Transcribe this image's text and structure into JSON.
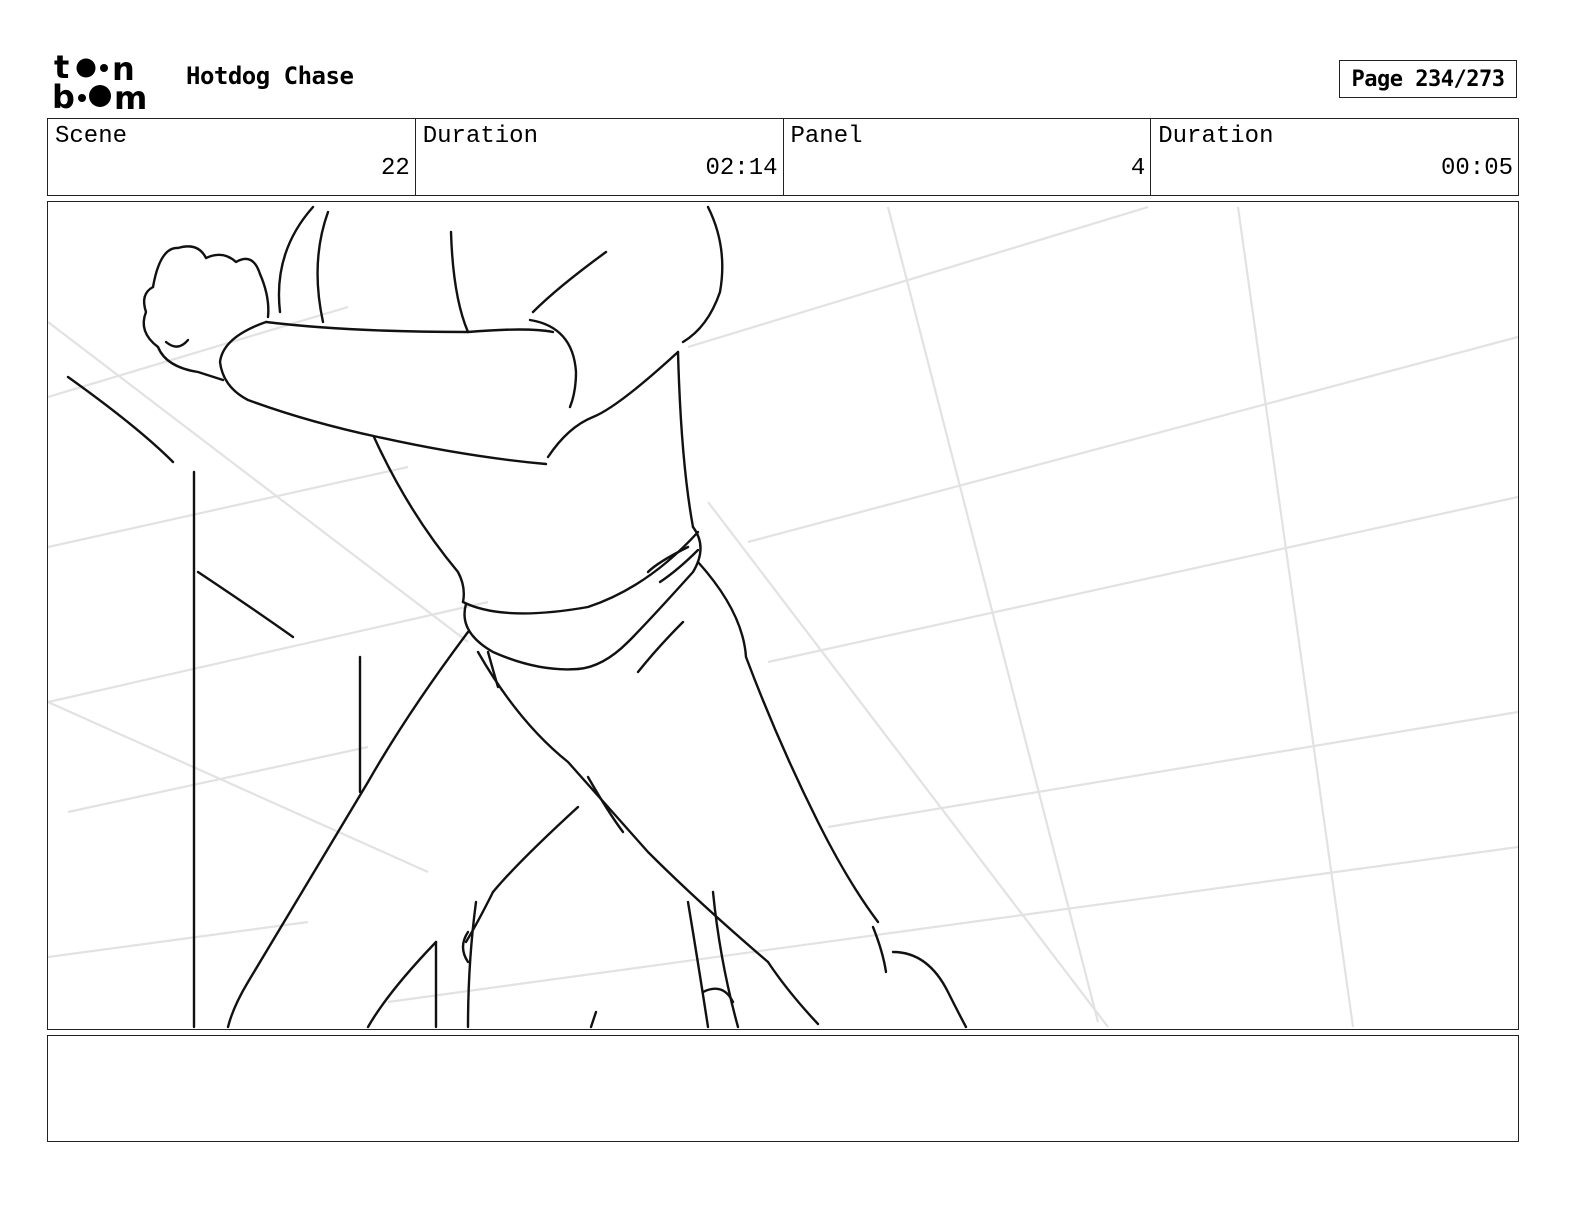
{
  "header": {
    "logo_icon": "toon-boom-logo",
    "project_title": "Hotdog Chase",
    "page_label": "Page 234/273"
  },
  "info": {
    "scene_label": "Scene",
    "scene_value": "22",
    "scene_duration_label": "Duration",
    "scene_duration_value": "02:14",
    "panel_label": "Panel",
    "panel_value": "4",
    "panel_duration_label": "Duration",
    "panel_duration_value": "00:05"
  },
  "panel": {
    "image_icon": "storyboard-sketch-figure-legs"
  },
  "notes": {
    "text": ""
  }
}
